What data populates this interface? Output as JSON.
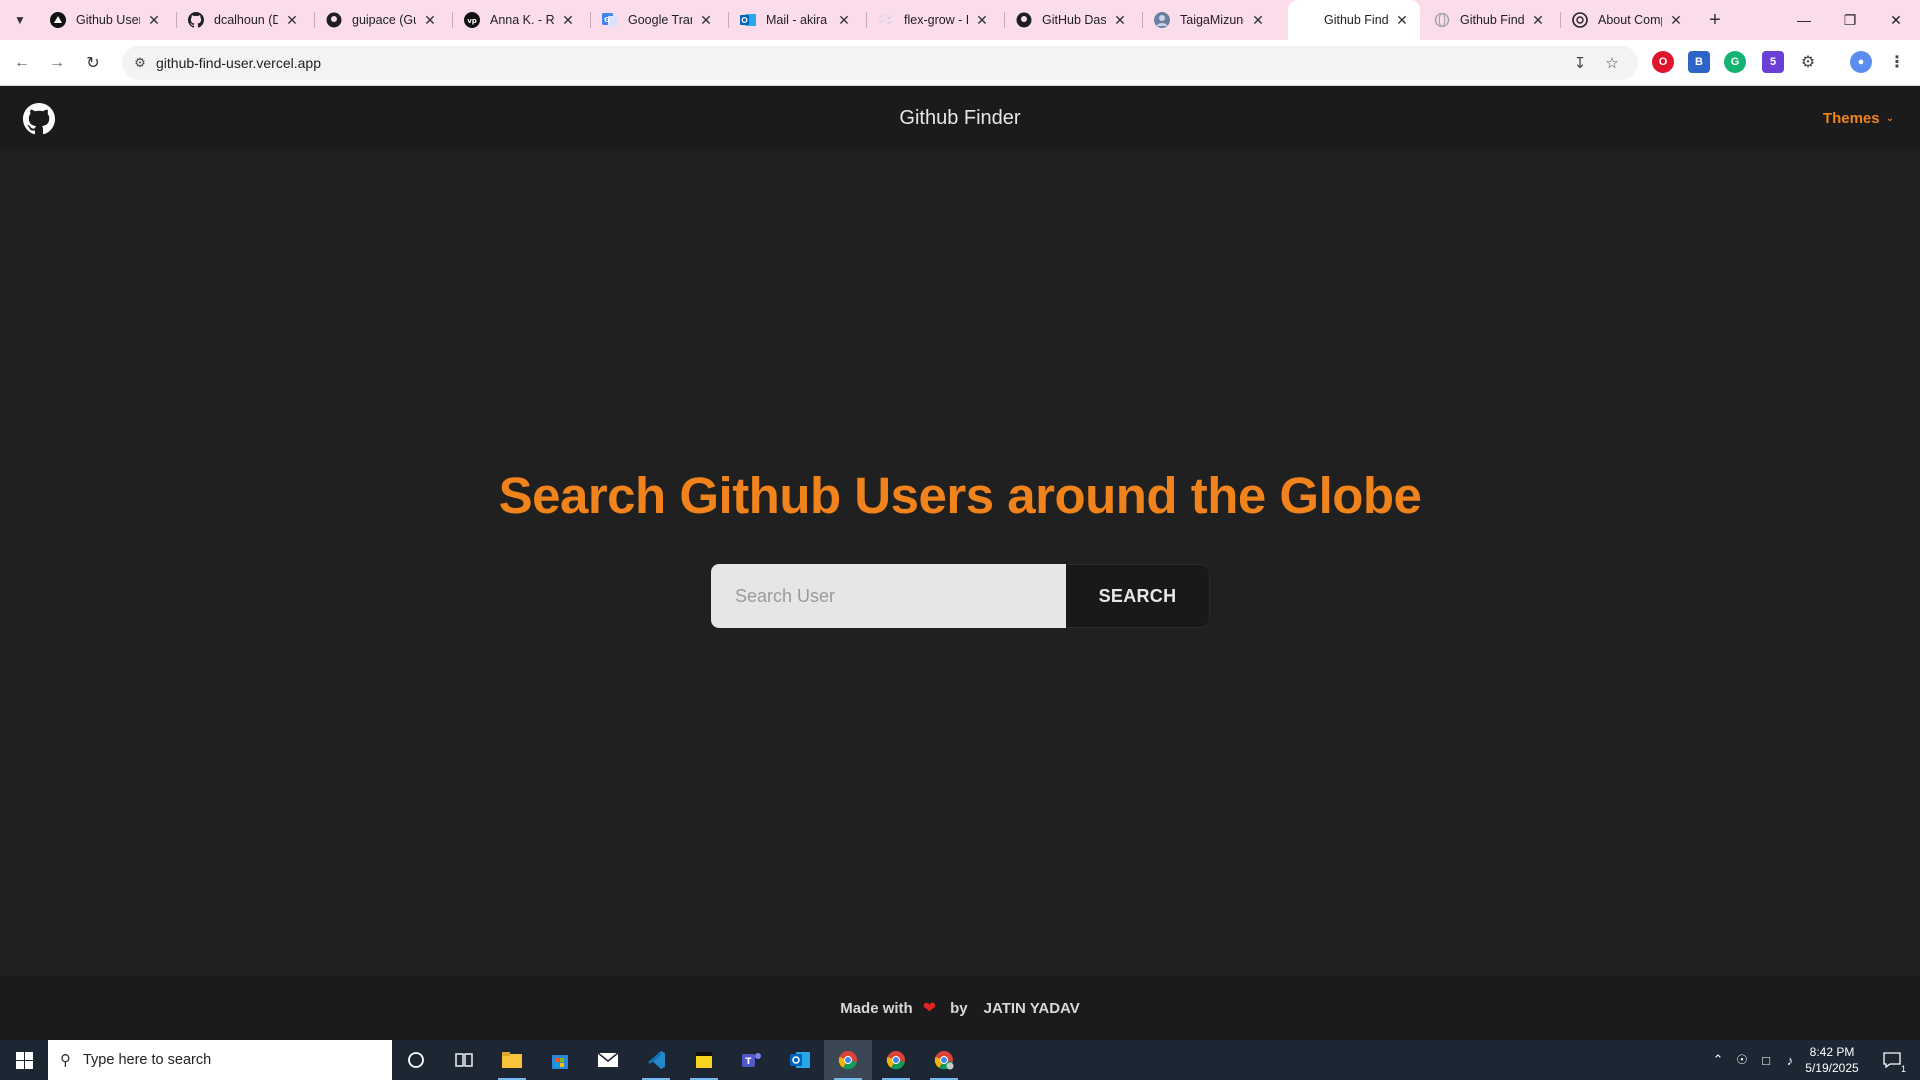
{
  "browser": {
    "tabs": [
      {
        "title": "Github Users",
        "favicon": "vercel-icon",
        "active": false
      },
      {
        "title": "dcalhoun (D",
        "favicon": "github-icon",
        "active": false
      },
      {
        "title": "guipace (Gu",
        "favicon": "github-icon",
        "active": false
      },
      {
        "title": "Anna K. - Ru",
        "favicon": "vp-icon",
        "active": false
      },
      {
        "title": "Google Tran",
        "favicon": "google-translate-icon",
        "active": false
      },
      {
        "title": "Mail - akira",
        "favicon": "outlook-icon",
        "active": false
      },
      {
        "title": "flex-grow - F",
        "favicon": "tailwind-icon",
        "active": false
      },
      {
        "title": "GitHub Dash",
        "favicon": "github-icon",
        "active": false
      },
      {
        "title": "TaigaMizuno",
        "favicon": "user-avatar-icon",
        "active": false
      },
      {
        "title": "Github Finde",
        "favicon": "blank-icon",
        "active": true
      },
      {
        "title": "Github Finde",
        "favicon": "globe-icon",
        "active": false
      },
      {
        "title": "About Comp",
        "favicon": "openai-icon",
        "active": false
      }
    ],
    "url": "github-find-user.vercel.app",
    "colors": {
      "tabstrip": "#fbdcea",
      "toolbar": "#ffffff"
    }
  },
  "app": {
    "title": "Github Finder",
    "themes_label": "Themes",
    "hero_heading": "Search Github Users around the Globe",
    "search_placeholder": "Search User",
    "search_button": "SEARCH",
    "footer": {
      "made_with": "Made with",
      "by": "by",
      "author": "JATIN YADAV"
    },
    "colors": {
      "accent": "#f0831b",
      "background": "#202020",
      "header": "#1b1b1b",
      "heart": "#e02424"
    }
  },
  "taskbar": {
    "search_placeholder": "Type here to search",
    "time": "8:42 PM",
    "date": "5/19/2025",
    "notification_count": "1",
    "extension_badge": "5"
  }
}
